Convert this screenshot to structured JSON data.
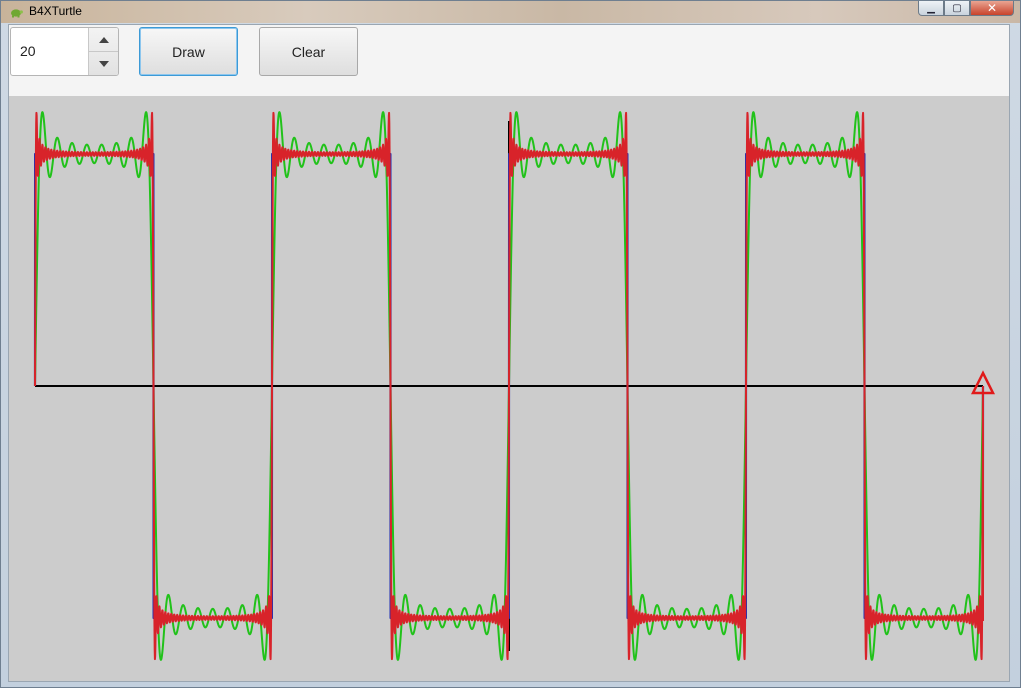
{
  "window": {
    "title": "B4XTurtle",
    "controls": {
      "minimize_glyph": "▁",
      "maximize_glyph": "▢",
      "close_glyph": "✕"
    }
  },
  "toolbar": {
    "spinner_value": "20",
    "draw_label": "Draw",
    "clear_label": "Clear"
  },
  "icons": {
    "app": "turtle-icon",
    "spin_up": "chevron-up-icon",
    "spin_down": "chevron-down-icon",
    "turtle_cursor": "triangle-turtle-icon"
  },
  "colors": {
    "canvas_bg": "#cccccc",
    "axis": "#000000",
    "series_blue": "#1f2fb3",
    "series_green": "#21c21a",
    "series_red": "#d8232a",
    "turtle": "#e01a1a"
  },
  "chart_data": {
    "type": "line",
    "title": "",
    "xlabel": "",
    "ylabel": "",
    "grid": false,
    "legend": "none",
    "periods": 4,
    "series": [
      {
        "name": "",
        "harmonics": 1000,
        "color": "#1f2fb3"
      },
      {
        "name": "",
        "harmonics": 8,
        "color": "#21c21a"
      },
      {
        "name": "",
        "harmonics": 40,
        "color": "#d8232a"
      }
    ]
  }
}
